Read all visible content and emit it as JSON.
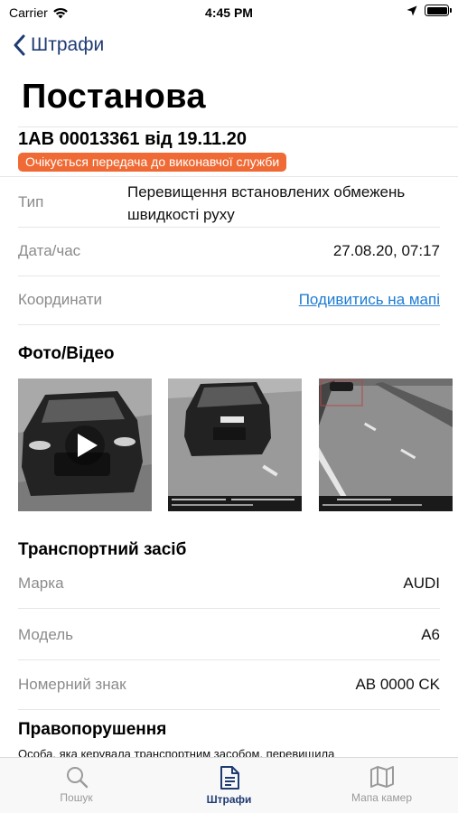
{
  "status_bar": {
    "carrier": "Carrier",
    "time": "4:45 PM"
  },
  "nav": {
    "back_label": "Штрафи"
  },
  "page": {
    "title": "Постанова"
  },
  "decree": {
    "number": "1АВ 00013361 від 19.11.20",
    "status": "Очікується передача до виконавчої служби"
  },
  "details": {
    "type_label": "Тип",
    "type_value": "Перевищення встановлених обмежень швидкості руху",
    "datetime_label": "Дата/час",
    "datetime_value": "27.08.20, 07:17",
    "coords_label": "Координати",
    "coords_link": "Подивитись на мапі"
  },
  "media": {
    "title": "Фото/Відео"
  },
  "vehicle": {
    "title": "Транспортний засіб",
    "brand_label": "Марка",
    "brand_value": "AUDI",
    "model_label": "Модель",
    "model_value": "A6",
    "plate_label": "Номерний знак",
    "plate_value": "AB 0000 CK"
  },
  "offense": {
    "title": "Правопорушення",
    "text": "Особа, яка керувала транспортним засобом, перевищила"
  },
  "tabs": [
    {
      "label": "Пошук",
      "icon": "search-icon"
    },
    {
      "label": "Штрафи",
      "icon": "document-icon"
    },
    {
      "label": "Мапа камер",
      "icon": "map-icon"
    }
  ],
  "colors": {
    "accent": "#1f3b73",
    "badge": "#ef6a34",
    "link": "#1d7bd4"
  }
}
